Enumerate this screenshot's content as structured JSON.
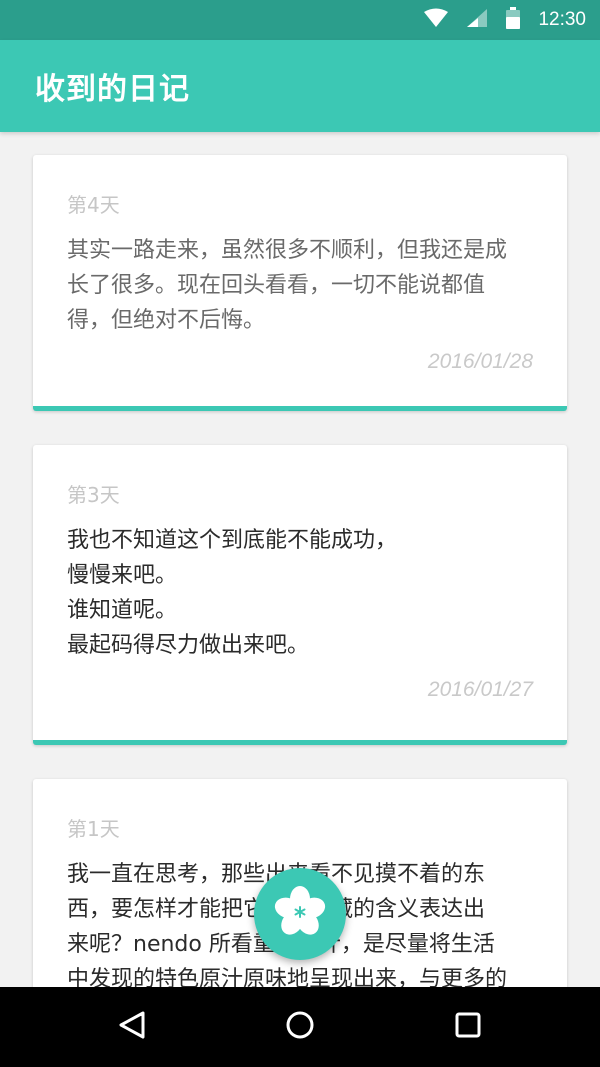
{
  "status_bar": {
    "time": "12:30",
    "icons": [
      "wifi-icon",
      "signal-icon",
      "battery-icon"
    ]
  },
  "app_bar": {
    "title": "收到的日记"
  },
  "cards": [
    {
      "day": "第4天",
      "lines": [
        "其实一路走来，虽然很多不顺利，但我还是成",
        "长了很多。现在回头看看，一切不能说都值",
        "得，但绝对不后悔。"
      ],
      "date": "2016/01/28"
    },
    {
      "day": "第3天",
      "lines": [
        "我也不知道这个到底能不能成功，",
        "慢慢来吧。",
        "谁知道呢。",
        "最起码得尽力做出来吧。"
      ],
      "date": "2016/01/27"
    },
    {
      "day": "第1天",
      "lines": [
        "我一直在思考，那些出来看不见摸不着的东",
        "西，要怎样才能把它们所隐藏的含义表达出",
        "来呢？nendo 所看重的设计，是尽量将生活",
        "中发现的特色原汁原味地呈现出来，与更多的"
      ]
    }
  ],
  "fab": {
    "icon": "flower-icon"
  },
  "nav_bar": {
    "icons": [
      "back-icon",
      "home-icon",
      "recents-icon"
    ]
  },
  "colors": {
    "accent": "#3cc8b4",
    "status_bar": "#2b9e8c",
    "nav_bar": "#000000"
  }
}
